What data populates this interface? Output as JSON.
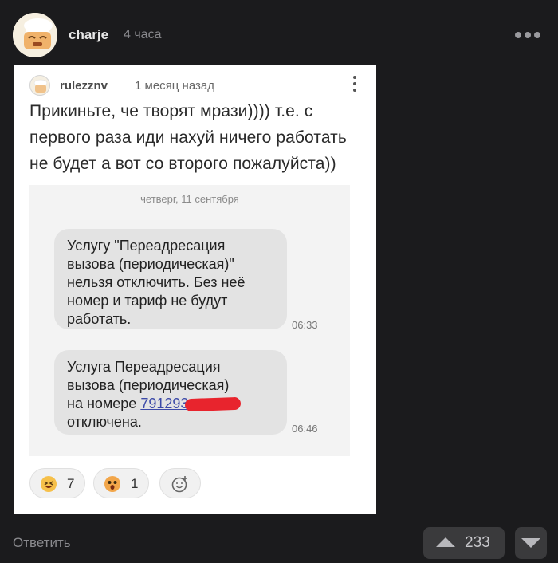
{
  "post": {
    "author": "charje",
    "time": "4 часа",
    "avatar_icon": "chef-face-icon",
    "more_icon": "more-dots-icon"
  },
  "screenshot": {
    "comment": {
      "user": "rulezznv",
      "date": "1 месяц назад",
      "text": "Прикиньте, че творят мрази)))) т.е. с первого раза иди нахуй ничего работать не будет а вот со второго пожалуйста))"
    },
    "sms": {
      "date": "четверг, 11 сентября",
      "messages": [
        {
          "lines": [
            "Услугу \"Переадресация",
            "вызова (периодическая)\"",
            "нельзя отключить. Без неё",
            "номер и тариф не будут",
            "работать."
          ],
          "time": "06:33"
        },
        {
          "line1": "Услуга Переадресация",
          "line2": "вызова (периодическая)",
          "line3_prefix": "на номере ",
          "number": "791293",
          "line4": "отключена.",
          "time": "06:46"
        }
      ]
    },
    "reactions": [
      {
        "icon": "laughing-face-icon",
        "count": "7"
      },
      {
        "icon": "shocked-face-icon",
        "count": "1"
      },
      {
        "icon": "add-reaction-icon",
        "count": ""
      }
    ]
  },
  "footer": {
    "reply": "Ответить",
    "rating": "233"
  }
}
